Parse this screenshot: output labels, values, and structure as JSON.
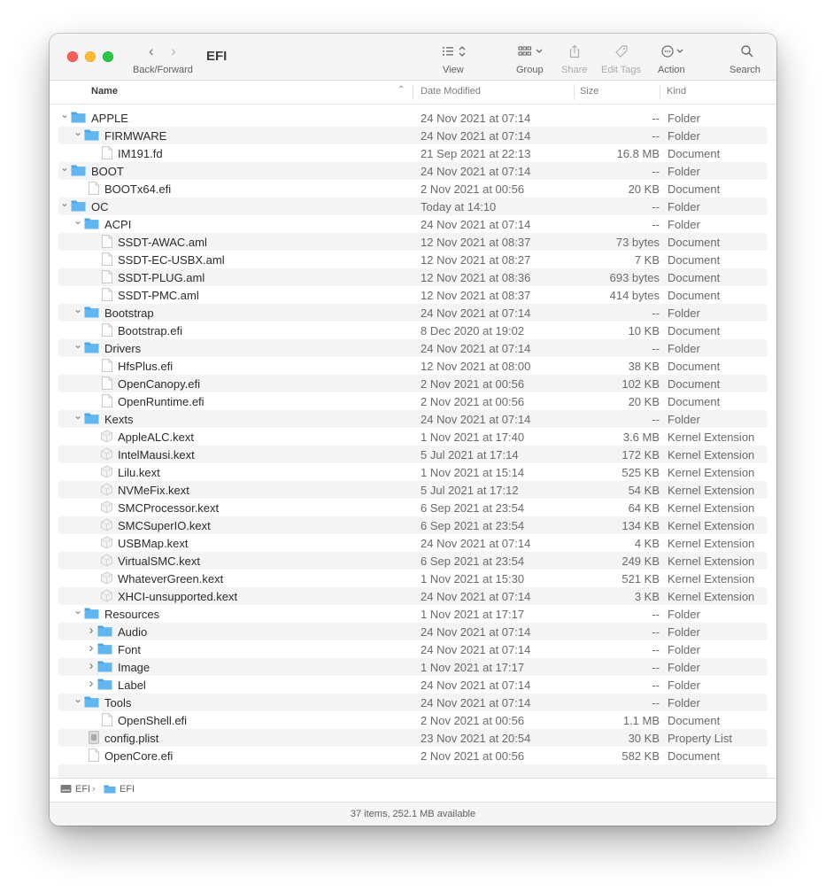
{
  "window": {
    "title": "EFI"
  },
  "toolbar": {
    "back_forward_label": "Back/Forward",
    "view_label": "View",
    "group_label": "Group",
    "share_label": "Share",
    "edit_tags_label": "Edit Tags",
    "action_label": "Action",
    "search_label": "Search"
  },
  "columns": {
    "name": "Name",
    "date_modified": "Date Modified",
    "size": "Size",
    "kind": "Kind"
  },
  "rows": [
    {
      "name": "APPLE",
      "date": "24 Nov 2021 at 07:14",
      "size": "--",
      "kind": "Folder",
      "level": 0,
      "type": "folder",
      "expanded": true
    },
    {
      "name": "FIRMWARE",
      "date": "24 Nov 2021 at 07:14",
      "size": "--",
      "kind": "Folder",
      "level": 1,
      "type": "folder",
      "expanded": true
    },
    {
      "name": "IM191.fd",
      "date": "21 Sep 2021 at 22:13",
      "size": "16.8 MB",
      "kind": "Document",
      "level": 2,
      "type": "doc"
    },
    {
      "name": "BOOT",
      "date": "24 Nov 2021 at 07:14",
      "size": "--",
      "kind": "Folder",
      "level": 0,
      "type": "folder",
      "expanded": true
    },
    {
      "name": "BOOTx64.efi",
      "date": "2 Nov 2021 at 00:56",
      "size": "20 KB",
      "kind": "Document",
      "level": 1,
      "type": "doc"
    },
    {
      "name": "OC",
      "date": "Today at 14:10",
      "size": "--",
      "kind": "Folder",
      "level": 0,
      "type": "folder",
      "expanded": true
    },
    {
      "name": "ACPI",
      "date": "24 Nov 2021 at 07:14",
      "size": "--",
      "kind": "Folder",
      "level": 1,
      "type": "folder",
      "expanded": true
    },
    {
      "name": "SSDT-AWAC.aml",
      "date": "12 Nov 2021 at 08:37",
      "size": "73 bytes",
      "kind": "Document",
      "level": 2,
      "type": "doc"
    },
    {
      "name": "SSDT-EC-USBX.aml",
      "date": "12 Nov 2021 at 08:27",
      "size": "7 KB",
      "kind": "Document",
      "level": 2,
      "type": "doc"
    },
    {
      "name": "SSDT-PLUG.aml",
      "date": "12 Nov 2021 at 08:36",
      "size": "693 bytes",
      "kind": "Document",
      "level": 2,
      "type": "doc"
    },
    {
      "name": "SSDT-PMC.aml",
      "date": "12 Nov 2021 at 08:37",
      "size": "414 bytes",
      "kind": "Document",
      "level": 2,
      "type": "doc"
    },
    {
      "name": "Bootstrap",
      "date": "24 Nov 2021 at 07:14",
      "size": "--",
      "kind": "Folder",
      "level": 1,
      "type": "folder",
      "expanded": true
    },
    {
      "name": "Bootstrap.efi",
      "date": "8 Dec 2020 at 19:02",
      "size": "10 KB",
      "kind": "Document",
      "level": 2,
      "type": "doc"
    },
    {
      "name": "Drivers",
      "date": "24 Nov 2021 at 07:14",
      "size": "--",
      "kind": "Folder",
      "level": 1,
      "type": "folder",
      "expanded": true
    },
    {
      "name": "HfsPlus.efi",
      "date": "12 Nov 2021 at 08:00",
      "size": "38 KB",
      "kind": "Document",
      "level": 2,
      "type": "doc"
    },
    {
      "name": "OpenCanopy.efi",
      "date": "2 Nov 2021 at 00:56",
      "size": "102 KB",
      "kind": "Document",
      "level": 2,
      "type": "doc"
    },
    {
      "name": "OpenRuntime.efi",
      "date": "2 Nov 2021 at 00:56",
      "size": "20 KB",
      "kind": "Document",
      "level": 2,
      "type": "doc"
    },
    {
      "name": "Kexts",
      "date": "24 Nov 2021 at 07:14",
      "size": "--",
      "kind": "Folder",
      "level": 1,
      "type": "folder",
      "expanded": true
    },
    {
      "name": "AppleALC.kext",
      "date": "1 Nov 2021 at 17:40",
      "size": "3.6 MB",
      "kind": "Kernel Extension",
      "level": 2,
      "type": "kext"
    },
    {
      "name": "IntelMausi.kext",
      "date": "5 Jul 2021 at 17:14",
      "size": "172 KB",
      "kind": "Kernel Extension",
      "level": 2,
      "type": "kext"
    },
    {
      "name": "Lilu.kext",
      "date": "1 Nov 2021 at 15:14",
      "size": "525 KB",
      "kind": "Kernel Extension",
      "level": 2,
      "type": "kext"
    },
    {
      "name": "NVMeFix.kext",
      "date": "5 Jul 2021 at 17:12",
      "size": "54 KB",
      "kind": "Kernel Extension",
      "level": 2,
      "type": "kext"
    },
    {
      "name": "SMCProcessor.kext",
      "date": "6 Sep 2021 at 23:54",
      "size": "64 KB",
      "kind": "Kernel Extension",
      "level": 2,
      "type": "kext"
    },
    {
      "name": "SMCSuperIO.kext",
      "date": "6 Sep 2021 at 23:54",
      "size": "134 KB",
      "kind": "Kernel Extension",
      "level": 2,
      "type": "kext"
    },
    {
      "name": "USBMap.kext",
      "date": "24 Nov 2021 at 07:14",
      "size": "4 KB",
      "kind": "Kernel Extension",
      "level": 2,
      "type": "kext"
    },
    {
      "name": "VirtualSMC.kext",
      "date": "6 Sep 2021 at 23:54",
      "size": "249 KB",
      "kind": "Kernel Extension",
      "level": 2,
      "type": "kext"
    },
    {
      "name": "WhateverGreen.kext",
      "date": "1 Nov 2021 at 15:30",
      "size": "521 KB",
      "kind": "Kernel Extension",
      "level": 2,
      "type": "kext"
    },
    {
      "name": "XHCI-unsupported.kext",
      "date": "24 Nov 2021 at 07:14",
      "size": "3 KB",
      "kind": "Kernel Extension",
      "level": 2,
      "type": "kext"
    },
    {
      "name": "Resources",
      "date": "1 Nov 2021 at 17:17",
      "size": "--",
      "kind": "Folder",
      "level": 1,
      "type": "folder",
      "expanded": true
    },
    {
      "name": "Audio",
      "date": "24 Nov 2021 at 07:14",
      "size": "--",
      "kind": "Folder",
      "level": 2,
      "type": "folder",
      "expanded": false
    },
    {
      "name": "Font",
      "date": "24 Nov 2021 at 07:14",
      "size": "--",
      "kind": "Folder",
      "level": 2,
      "type": "folder",
      "expanded": false
    },
    {
      "name": "Image",
      "date": "1 Nov 2021 at 17:17",
      "size": "--",
      "kind": "Folder",
      "level": 2,
      "type": "folder",
      "expanded": false
    },
    {
      "name": "Label",
      "date": "24 Nov 2021 at 07:14",
      "size": "--",
      "kind": "Folder",
      "level": 2,
      "type": "folder",
      "expanded": false
    },
    {
      "name": "Tools",
      "date": "24 Nov 2021 at 07:14",
      "size": "--",
      "kind": "Folder",
      "level": 1,
      "type": "folder",
      "expanded": true
    },
    {
      "name": "OpenShell.efi",
      "date": "2 Nov 2021 at 00:56",
      "size": "1.1 MB",
      "kind": "Document",
      "level": 2,
      "type": "doc"
    },
    {
      "name": "config.plist",
      "date": "23 Nov 2021 at 20:54",
      "size": "30 KB",
      "kind": "Property List",
      "level": 1,
      "type": "plist"
    },
    {
      "name": "OpenCore.efi",
      "date": "2 Nov 2021 at 00:56",
      "size": "582 KB",
      "kind": "Document",
      "level": 1,
      "type": "doc"
    }
  ],
  "pathbar": {
    "volume": "EFI",
    "folder": "EFI"
  },
  "status": {
    "text": "37 items, 252.1 MB available"
  },
  "colors": {
    "folder": "#5fb6f0",
    "folder_tab": "#4aa5e6"
  }
}
